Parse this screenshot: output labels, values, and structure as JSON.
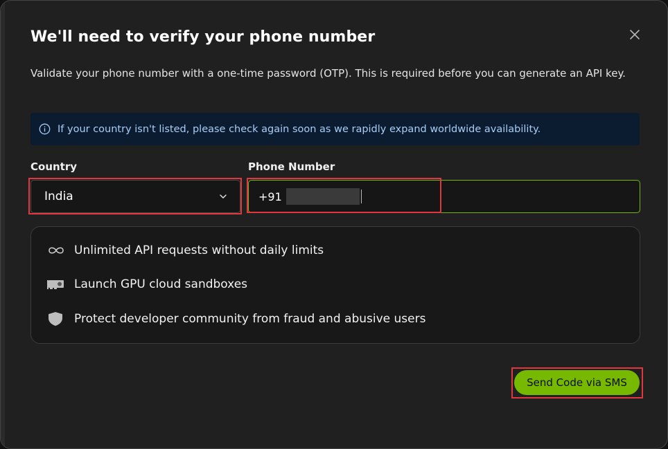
{
  "dialog": {
    "title": "We'll need to verify your phone number",
    "description": "Validate your phone number with a one-time password (OTP). This is required before you can generate an API key.",
    "info_banner": "If your country isn't listed, please check again soon as we rapidly expand worldwide availability."
  },
  "form": {
    "country_label": "Country",
    "country_value": "India",
    "phone_label": "Phone Number",
    "phone_prefix": "+91"
  },
  "features": [
    {
      "icon": "infinity-icon",
      "label": "Unlimited API requests without daily limits"
    },
    {
      "icon": "gpu-card-icon",
      "label": "Launch GPU cloud sandboxes"
    },
    {
      "icon": "shield-icon",
      "label": "Protect developer community from fraud and abusive users"
    }
  ],
  "actions": {
    "send_label": "Send Code via SMS"
  },
  "colors": {
    "accent": "#76b900",
    "dialog_bg": "#202020",
    "info_bg": "#0b1c31",
    "info_text": "#a9cdf5",
    "annotation": "#e0383e"
  }
}
